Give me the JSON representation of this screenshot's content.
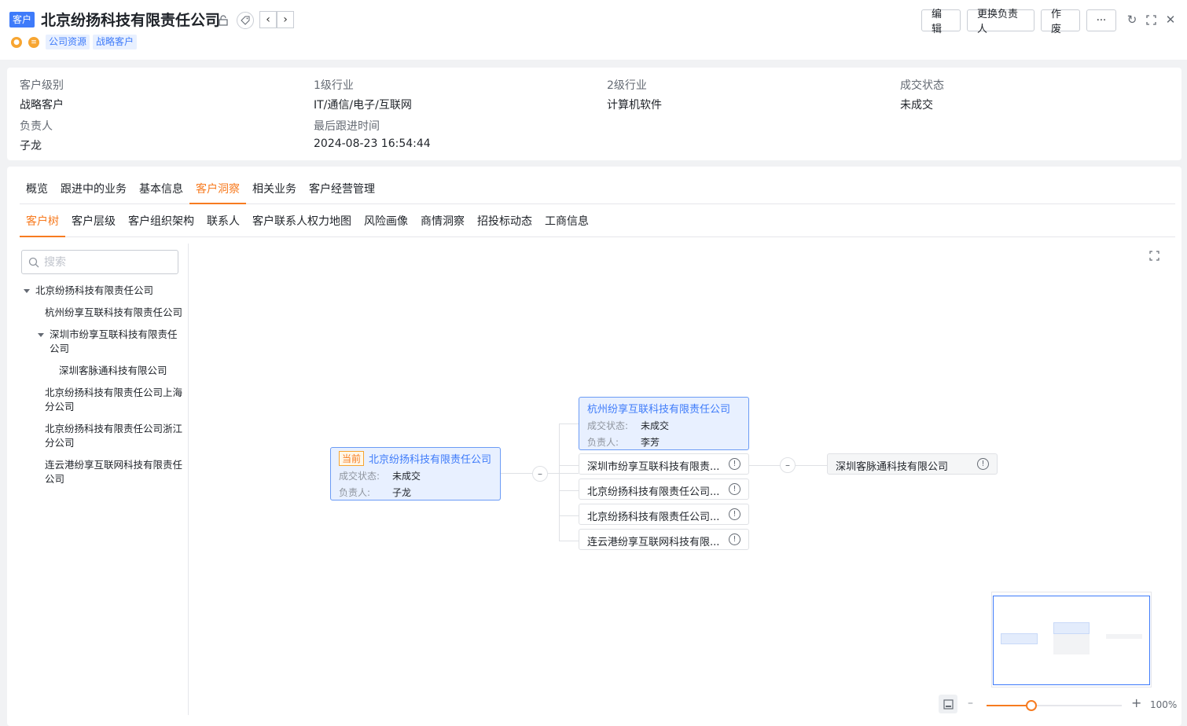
{
  "header": {
    "type_tag": "客户",
    "title": "北京纷扬科技有限责任公司",
    "tags": [
      "公司资源",
      "战略客户"
    ],
    "buttons": {
      "edit": "编辑",
      "change_owner": "更换负责人",
      "void": "作废",
      "more": "···"
    },
    "icons": [
      "lock-icon",
      "tag-icon",
      "chevron-left-icon",
      "chevron-right-icon",
      "location-icon",
      "coin-icon",
      "refresh-icon",
      "expand-icon",
      "close-icon"
    ]
  },
  "info": {
    "fields": [
      {
        "label": "客户级别",
        "value": "战略客户"
      },
      {
        "label": "1级行业",
        "value": "IT/通信/电子/互联网"
      },
      {
        "label": "2级行业",
        "value": "计算机软件"
      },
      {
        "label": "成交状态",
        "value": "未成交"
      },
      {
        "label": "负责人",
        "value": "子龙"
      },
      {
        "label": "最后跟进时间",
        "value": "2024-08-23 16:54:44"
      }
    ]
  },
  "tabs": {
    "primary": [
      "概览",
      "跟进中的业务",
      "基本信息",
      "客户洞察",
      "相关业务",
      "客户经营管理"
    ],
    "primary_active": "客户洞察",
    "secondary": [
      "客户树",
      "客户层级",
      "客户组织架构",
      "联系人",
      "客户联系人权力地图",
      "风险画像",
      "商情洞察",
      "招投标动态",
      "工商信息"
    ],
    "secondary_active": "客户树"
  },
  "sidebar": {
    "search_placeholder": "搜索",
    "tree": [
      {
        "label": "北京纷扬科技有限责任公司"
      },
      {
        "label": "杭州纷享互联科技有限责任公司"
      },
      {
        "label": "深圳市纷享互联科技有限责任",
        "label2": "公司"
      },
      {
        "label": "深圳客脉通科技有限公司"
      },
      {
        "label": "北京纷扬科技有限责任公司上海",
        "label2": "分公司"
      },
      {
        "label": "北京纷扬科技有限责任公司浙江",
        "label2": "分公司"
      },
      {
        "label": "连云港纷享互联网科技有限责任",
        "label2": "公司"
      }
    ]
  },
  "graph": {
    "current_badge": "当前",
    "root": {
      "name": "北京纷扬科技有限责任公司",
      "status_label": "成交状态:",
      "status": "未成交",
      "owner_label": "负责人:",
      "owner": "子龙"
    },
    "child_main": {
      "name": "杭州纷享互联科技有限责任公司",
      "status_label": "成交状态:",
      "status": "未成交",
      "owner_label": "负责人:",
      "owner": "李芳"
    },
    "children": [
      "深圳市纷享互联科技有限责...",
      "北京纷扬科技有限责任公司...",
      "北京纷扬科技有限责任公司...",
      "连云港纷享互联网科技有限..."
    ],
    "grandchild": "深圳客脉通科技有限公司",
    "collapse_symbol": "–",
    "info_symbol": "!"
  },
  "zoom": {
    "level": "100%",
    "fraction": 0.33,
    "minus": "–",
    "plus": "+"
  }
}
